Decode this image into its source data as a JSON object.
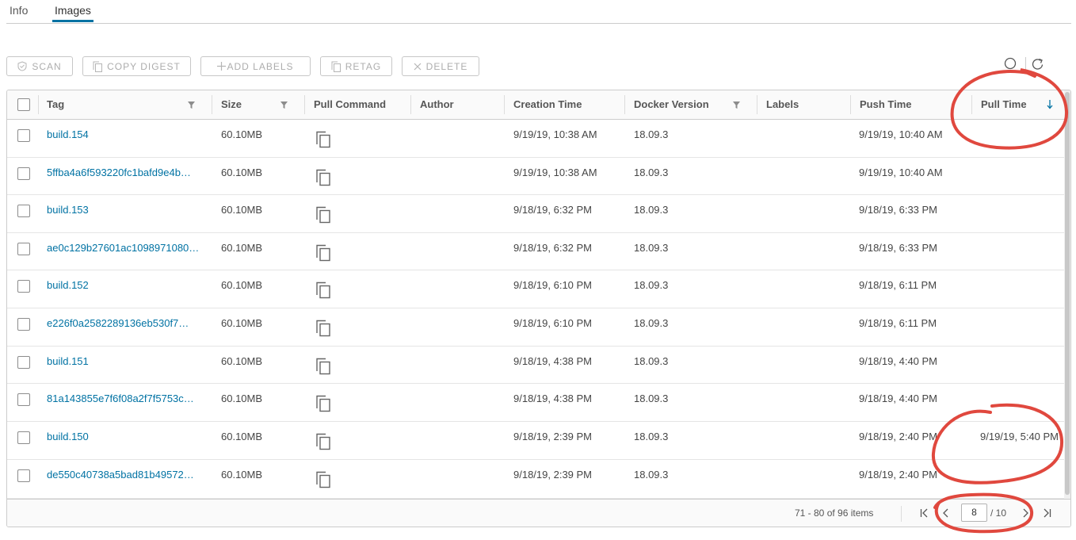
{
  "tabs": [
    {
      "label": "Info"
    },
    {
      "label": "Images",
      "active": true
    }
  ],
  "toolbar": {
    "scan": "SCAN",
    "copy_digest": "COPY DIGEST",
    "add_labels": "ADD LABELS",
    "retag": "RETAG",
    "delete": "DELETE"
  },
  "columns": {
    "tag": "Tag",
    "size": "Size",
    "pull_command": "Pull Command",
    "author": "Author",
    "creation_time": "Creation Time",
    "docker_version": "Docker Version",
    "labels": "Labels",
    "push_time": "Push Time",
    "pull_time": "Pull Time"
  },
  "rows": [
    {
      "tag": "build.154",
      "size": "60.10MB",
      "creation_time": "9/19/19, 10:38 AM",
      "docker_version": "18.09.3",
      "push_time": "9/19/19, 10:40 AM",
      "pull_time": ""
    },
    {
      "tag": "5ffba4a6f593220fc1bafd9e4b…",
      "size": "60.10MB",
      "creation_time": "9/19/19, 10:38 AM",
      "docker_version": "18.09.3",
      "push_time": "9/19/19, 10:40 AM",
      "pull_time": ""
    },
    {
      "tag": "build.153",
      "size": "60.10MB",
      "creation_time": "9/18/19, 6:32 PM",
      "docker_version": "18.09.3",
      "push_time": "9/18/19, 6:33 PM",
      "pull_time": ""
    },
    {
      "tag": "ae0c129b27601ac1098971080…",
      "size": "60.10MB",
      "creation_time": "9/18/19, 6:32 PM",
      "docker_version": "18.09.3",
      "push_time": "9/18/19, 6:33 PM",
      "pull_time": ""
    },
    {
      "tag": "build.152",
      "size": "60.10MB",
      "creation_time": "9/18/19, 6:10 PM",
      "docker_version": "18.09.3",
      "push_time": "9/18/19, 6:11 PM",
      "pull_time": ""
    },
    {
      "tag": "e226f0a2582289136eb530f7…",
      "size": "60.10MB",
      "creation_time": "9/18/19, 6:10 PM",
      "docker_version": "18.09.3",
      "push_time": "9/18/19, 6:11 PM",
      "pull_time": ""
    },
    {
      "tag": "build.151",
      "size": "60.10MB",
      "creation_time": "9/18/19, 4:38 PM",
      "docker_version": "18.09.3",
      "push_time": "9/18/19, 4:40 PM",
      "pull_time": ""
    },
    {
      "tag": "81a143855e7f6f08a2f7f5753c…",
      "size": "60.10MB",
      "creation_time": "9/18/19, 4:38 PM",
      "docker_version": "18.09.3",
      "push_time": "9/18/19, 4:40 PM",
      "pull_time": ""
    },
    {
      "tag": "build.150",
      "size": "60.10MB",
      "creation_time": "9/18/19, 2:39 PM",
      "docker_version": "18.09.3",
      "push_time": "9/18/19, 2:40 PM",
      "pull_time": "9/19/19, 5:40 PM"
    },
    {
      "tag": "de550c40738a5bad81b49572…",
      "size": "60.10MB",
      "creation_time": "9/18/19, 2:39 PM",
      "docker_version": "18.09.3",
      "push_time": "9/18/19, 2:40 PM",
      "pull_time": ""
    }
  ],
  "footer": {
    "range": "71 - 80 of 96 items",
    "current_page": "8",
    "total_pages": "/ 10"
  },
  "colors": {
    "link": "#0072a3",
    "annotation": "#e0483e"
  }
}
